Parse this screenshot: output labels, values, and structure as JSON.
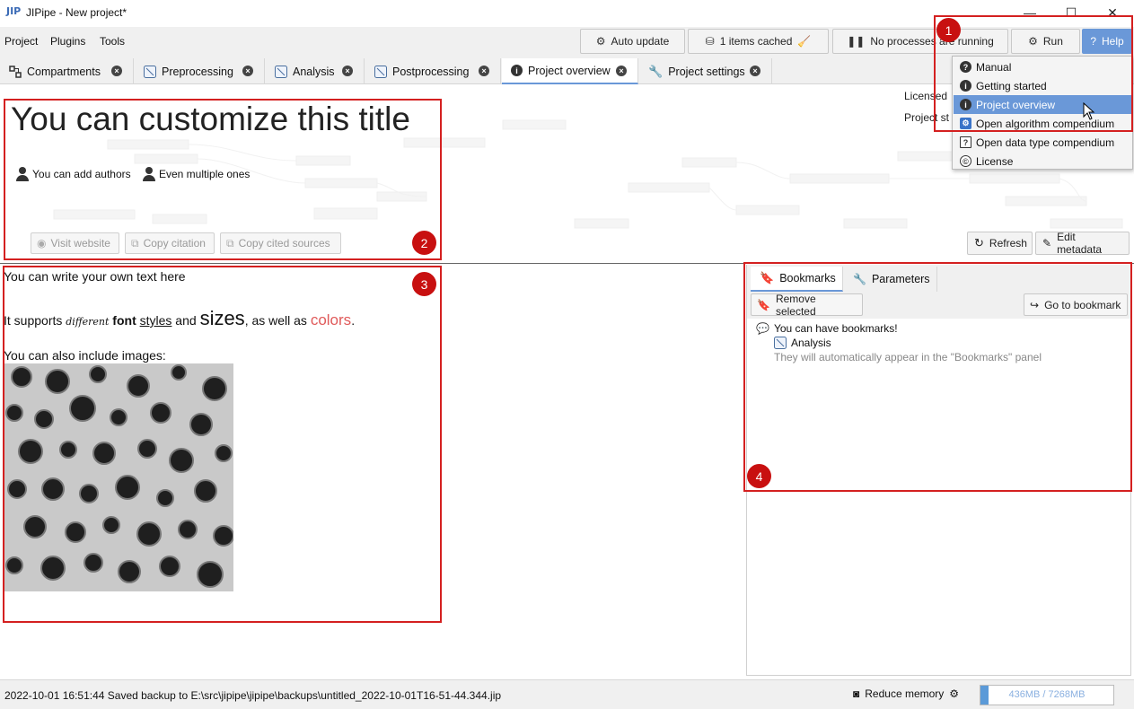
{
  "window": {
    "logo": "JIP",
    "title": "JIPipe - New project*",
    "minimize": "—",
    "maximize": "☐",
    "close": "✕"
  },
  "menubar": {
    "menus": [
      "Project",
      "Plugins",
      "Tools"
    ],
    "auto_update": "Auto update",
    "cached": "1 items cached",
    "processes": "No processes are running",
    "run": "Run",
    "help": "Help"
  },
  "tabs": [
    {
      "label": "Compartments"
    },
    {
      "label": "Preprocessing"
    },
    {
      "label": "Analysis"
    },
    {
      "label": "Postprocessing"
    },
    {
      "label": "Project overview"
    },
    {
      "label": "Project settings"
    }
  ],
  "overview": {
    "title": "You can customize this title",
    "authors": [
      "You can add authors",
      "Even multiple ones"
    ],
    "visit_website": "Visit website",
    "copy_citation": "Copy citation",
    "copy_cited_sources": "Copy cited sources",
    "licensed_label": "Licensed",
    "project_status_label": "Project st",
    "refresh": "Refresh",
    "edit_metadata": "Edit metadata"
  },
  "description": {
    "line1": "You can write your own text here",
    "line2_prefix": "It supports ",
    "line2_different": "different",
    "line2_font": "font",
    "line2_styles": "styles",
    "line2_and": " and ",
    "line2_sizes": "sizes",
    "line2_aswell": ", as well as ",
    "line2_colors": "colors",
    "line2_end": ".",
    "line3": "You can also include images:"
  },
  "right_panel": {
    "tab_bookmarks": "Bookmarks",
    "tab_parameters": "Parameters",
    "remove_selected": "Remove selected",
    "go_to_bookmark": "Go to bookmark",
    "bookmark_title": "You can have bookmarks!",
    "bookmark_target": "Analysis",
    "bookmark_note": "They will automatically appear in the \"Bookmarks\" panel"
  },
  "help_menu": {
    "items": [
      {
        "label": "Manual",
        "icon": "?"
      },
      {
        "label": "Getting started",
        "icon": "i"
      },
      {
        "label": "Project overview",
        "icon": "i"
      },
      {
        "label": "Open algorithm compendium",
        "icon": "⚙"
      },
      {
        "label": "Open data type compendium",
        "icon": "?"
      },
      {
        "label": "License",
        "icon": "©"
      }
    ]
  },
  "statusbar": {
    "message": "2022-10-01 16:51:44 Saved backup to E:\\src\\jipipe\\jipipe\\backups\\untitled_2022-10-01T16-51-44.344.jip",
    "reduce_memory": "Reduce memory",
    "memory": "436MB / 7268MB",
    "memory_used_fraction": 0.06
  },
  "callouts": [
    "1",
    "2",
    "3",
    "4"
  ],
  "colors": {
    "accent": "#6a98d8",
    "callout": "#d42020",
    "text_color_sample": "#e05a5a"
  }
}
